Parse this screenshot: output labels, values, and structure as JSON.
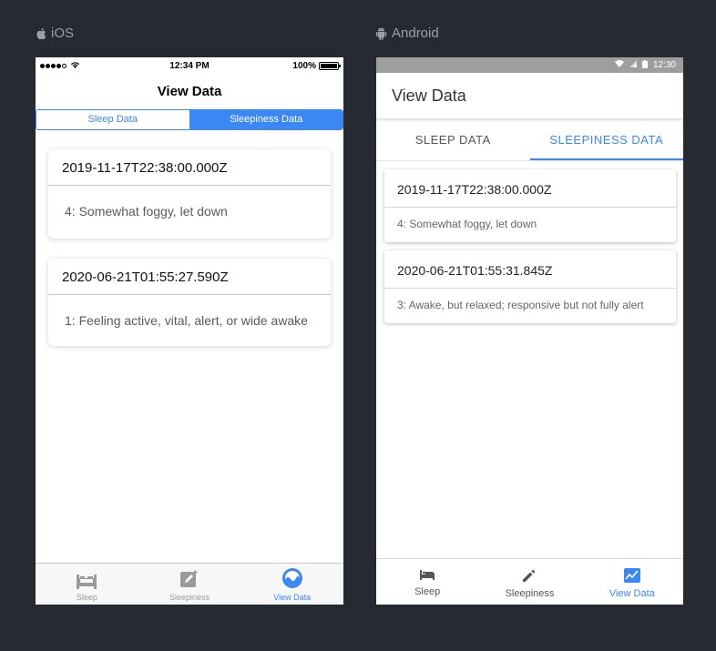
{
  "ios": {
    "label": "iOS",
    "status": {
      "time": "12:34 PM",
      "battery": "100%"
    },
    "title": "View Data",
    "segments": [
      {
        "label": "Sleep Data",
        "active": false
      },
      {
        "label": "Sleepiness Data",
        "active": true
      }
    ],
    "cards": [
      {
        "timestamp": "2019-11-17T22:38:00.000Z",
        "value": "4: Somewhat foggy, let down"
      },
      {
        "timestamp": "2020-06-21T01:55:27.590Z",
        "value": "1: Feeling active, vital, alert, or wide awake"
      }
    ],
    "tabs": [
      {
        "label": "Sleep",
        "icon": "bed-icon",
        "active": false
      },
      {
        "label": "Sleepiness",
        "icon": "pencil-icon",
        "active": false
      },
      {
        "label": "View Data",
        "icon": "chart-icon",
        "active": true
      }
    ]
  },
  "android": {
    "label": "Android",
    "status": {
      "time": "12:30"
    },
    "title": "View Data",
    "tabs": [
      {
        "label": "SLEEP DATA",
        "active": false
      },
      {
        "label": "SLEEPINESS DATA",
        "active": true
      }
    ],
    "cards": [
      {
        "timestamp": "2019-11-17T22:38:00.000Z",
        "value": "4: Somewhat foggy, let down"
      },
      {
        "timestamp": "2020-06-21T01:55:31.845Z",
        "value": "3: Awake, but relaxed; responsive but not fully alert"
      }
    ],
    "nav": [
      {
        "label": "Sleep",
        "icon": "bed-icon",
        "active": false
      },
      {
        "label": "Sleepiness",
        "icon": "pencil-icon",
        "active": false
      },
      {
        "label": "View Data",
        "icon": "chart-icon",
        "active": true
      }
    ]
  },
  "colors": {
    "accent": "#3b88f5",
    "background": "#262a31"
  }
}
